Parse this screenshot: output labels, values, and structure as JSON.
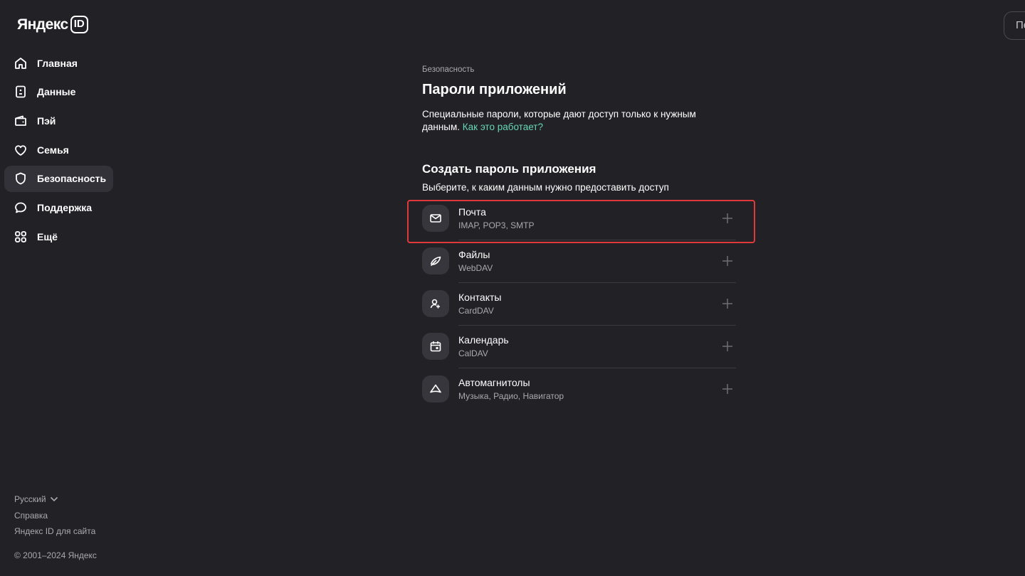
{
  "logo": {
    "text": "Яндекс",
    "badge": "ID"
  },
  "top_button": {
    "label": "По"
  },
  "sidebar": {
    "items": [
      {
        "label": "Главная",
        "icon": "home-icon"
      },
      {
        "label": "Данные",
        "icon": "id-card-icon"
      },
      {
        "label": "Пэй",
        "icon": "wallet-icon"
      },
      {
        "label": "Семья",
        "icon": "heart-icon"
      },
      {
        "label": "Безопасность",
        "icon": "shield-icon",
        "active": true
      },
      {
        "label": "Поддержка",
        "icon": "chat-icon"
      },
      {
        "label": "Ещё",
        "icon": "grid-icon"
      }
    ],
    "footer": {
      "language": "Русский",
      "help": "Справка",
      "for_site": "Яндекс ID для сайта",
      "copyright": "© 2001–2024 Яндекс"
    }
  },
  "main": {
    "breadcrumb": "Безопасность",
    "title": "Пароли приложений",
    "description": "Специальные пароли, которые дают доступ только к нужным данным.",
    "help_link": "Как это работает?",
    "create_title": "Создать пароль приложения",
    "create_subtitle": "Выберите, к каким данным нужно предоставить доступ",
    "apps": [
      {
        "name": "Почта",
        "protocols": "IMAP, POP3, SMTP",
        "icon": "mail-icon",
        "highlighted": true
      },
      {
        "name": "Файлы",
        "protocols": "WebDAV",
        "icon": "disk-icon"
      },
      {
        "name": "Контакты",
        "protocols": "CardDAV",
        "icon": "contacts-icon"
      },
      {
        "name": "Календарь",
        "protocols": "CalDAV",
        "icon": "calendar-icon"
      },
      {
        "name": "Автомагнитолы",
        "protocols": "Музыка, Радио, Навигатор",
        "icon": "car-audio-icon"
      }
    ]
  },
  "colors": {
    "background": "#222126",
    "active_nav": "#333238",
    "link": "#65d6b6",
    "highlight": "#e0393b",
    "muted_text": "#a9a9ae"
  }
}
